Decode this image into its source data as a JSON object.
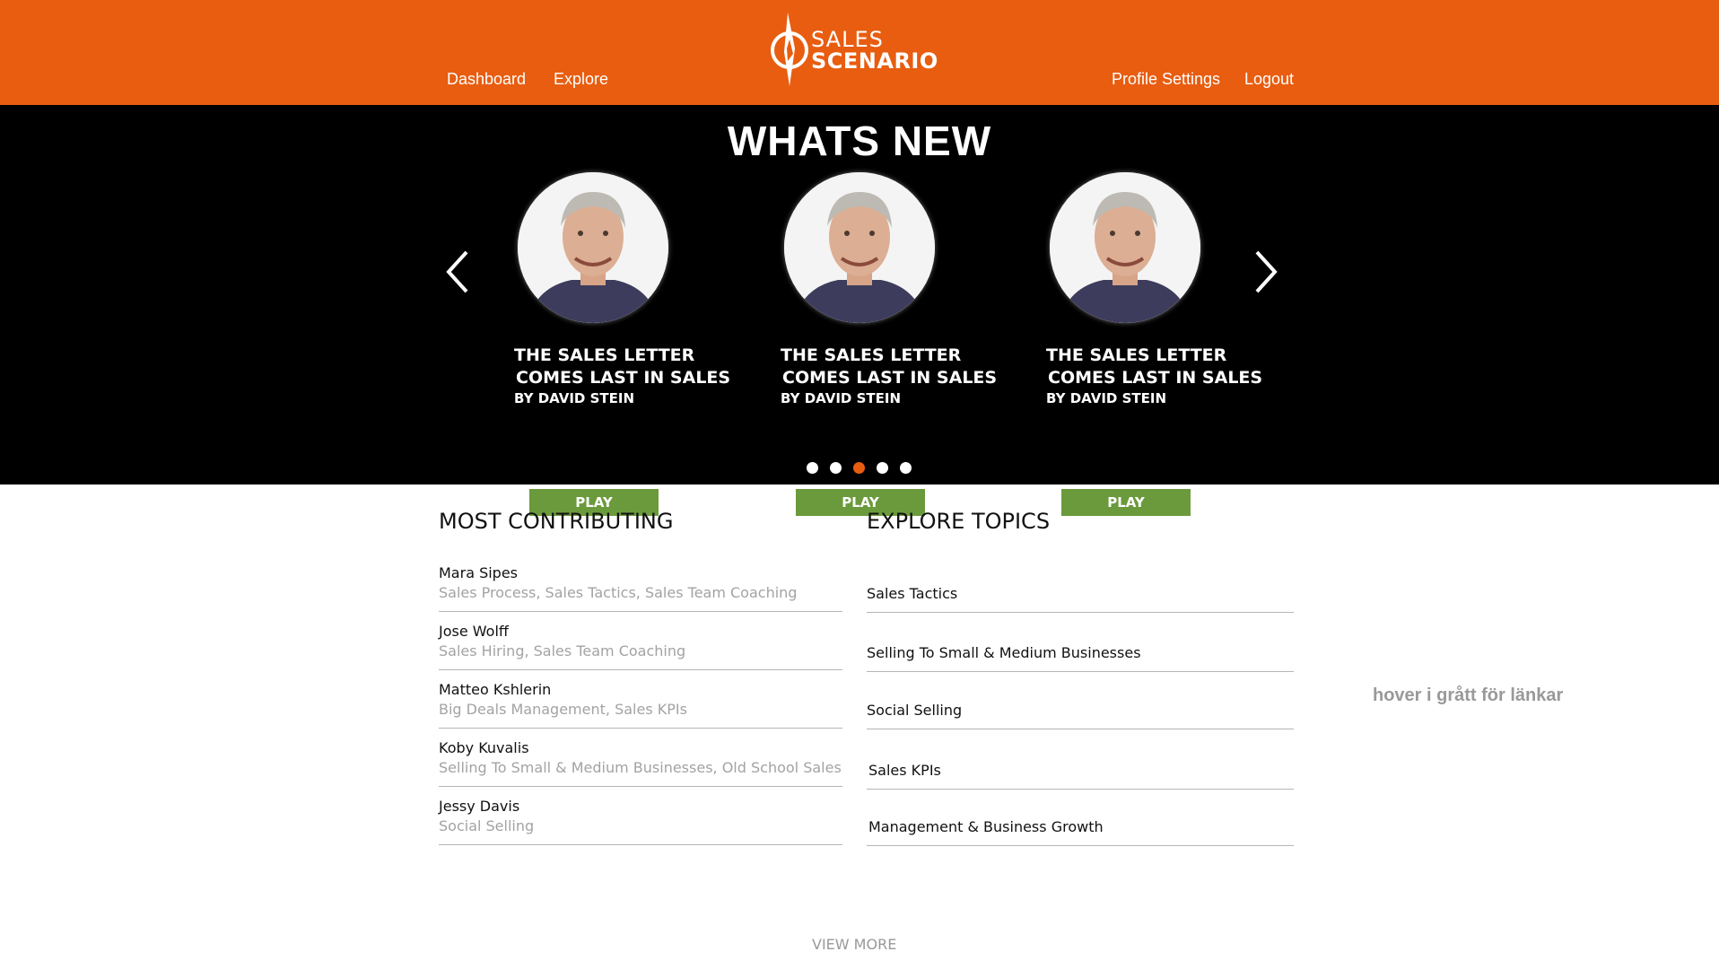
{
  "header": {
    "logo": {
      "line1": "SALES",
      "line2": "SCENARIO"
    },
    "nav_left": [
      {
        "label": "Dashboard"
      },
      {
        "label": "Explore"
      }
    ],
    "nav_right": [
      {
        "label": "Profile Settings"
      },
      {
        "label": "Logout"
      }
    ],
    "brand_color": "#e85d10"
  },
  "carousel": {
    "title": "WHATS NEW",
    "prev_icon": "chevron-left-icon",
    "next_icon": "chevron-right-icon",
    "cards": [
      {
        "title_line1": "THE SALES LETTER",
        "title_line2": "COMES LAST IN SALES",
        "author": "BY DAVID STEIN",
        "play_label": "PLAY"
      },
      {
        "title_line1": "THE SALES LETTER",
        "title_line2": "COMES LAST IN SALES",
        "author": "BY DAVID STEIN",
        "play_label": "PLAY"
      },
      {
        "title_line1": "THE SALES LETTER",
        "title_line2": "COMES LAST IN SALES",
        "author": "BY DAVID STEIN",
        "play_label": "PLAY"
      }
    ],
    "dots_count": 5,
    "active_dot": 3,
    "play_color": "#6b9a3c"
  },
  "most_contributing": {
    "title": "MOST CONTRIBUTING",
    "items": [
      {
        "name": "Mara Sipes",
        "topics": "Sales Process, Sales Tactics, Sales Team Coaching"
      },
      {
        "name": "Jose Wolff",
        "topics": "Sales Hiring, Sales Team Coaching"
      },
      {
        "name": "Matteo Kshlerin",
        "topics": "Big Deals Management, Sales KPIs"
      },
      {
        "name": "Koby Kuvalis",
        "topics": "Selling To Small & Medium Businesses, Old School Sales"
      },
      {
        "name": "Jessy Davis",
        "topics": "Social Selling"
      }
    ]
  },
  "explore_topics": {
    "title": "EXPLORE TOPICS",
    "items": [
      {
        "label": "Sales Tactics"
      },
      {
        "label": "Selling To Small & Medium Businesses"
      },
      {
        "label": "Social Selling"
      },
      {
        "label": "Sales KPIs"
      },
      {
        "label": "Management & Business Growth"
      }
    ]
  },
  "hover_note": "hover i grått för länkar",
  "view_more": "VIEW MORE"
}
